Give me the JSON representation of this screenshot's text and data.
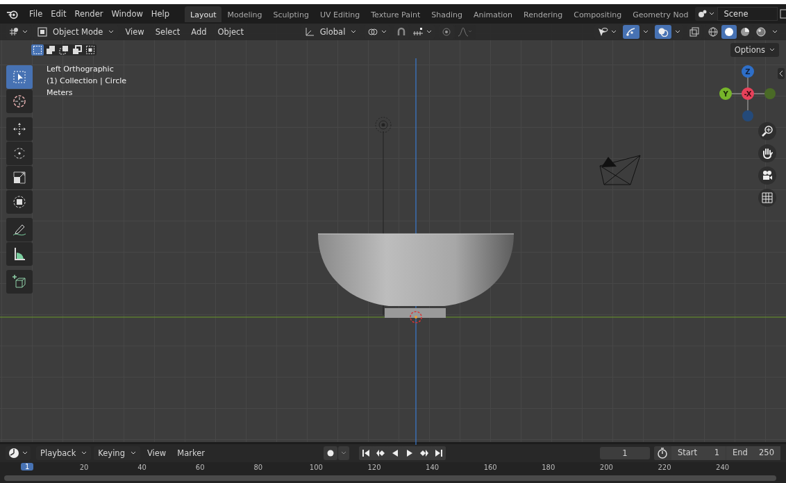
{
  "menu": [
    "File",
    "Edit",
    "Render",
    "Window",
    "Help"
  ],
  "workspaces": [
    {
      "label": "Layout",
      "selected": true
    },
    {
      "label": "Modeling",
      "selected": false
    },
    {
      "label": "Sculpting",
      "selected": false
    },
    {
      "label": "UV Editing",
      "selected": false
    },
    {
      "label": "Texture Paint",
      "selected": false
    },
    {
      "label": "Shading",
      "selected": false
    },
    {
      "label": "Animation",
      "selected": false
    },
    {
      "label": "Rendering",
      "selected": false
    },
    {
      "label": "Compositing",
      "selected": false
    },
    {
      "label": "Geometry Nod",
      "selected": false
    }
  ],
  "scene": "Scene",
  "header": {
    "mode": "Object Mode",
    "menus": [
      "View",
      "Select",
      "Add",
      "Object"
    ],
    "orientation": "Global",
    "snap": {
      "on": false
    },
    "proportional_editing": {
      "on": false
    },
    "gizmos": {
      "on": true
    },
    "overlays": {
      "on": true
    },
    "xray": {
      "on": false
    },
    "shading": [
      {
        "kind": "wireframe",
        "selected": false
      },
      {
        "kind": "solid",
        "selected": true
      },
      {
        "kind": "material",
        "selected": false
      },
      {
        "kind": "rendered",
        "selected": false
      }
    ]
  },
  "select_modes": [
    {
      "kind": "new",
      "selected": true
    },
    {
      "kind": "extend",
      "selected": false
    },
    {
      "kind": "subtract",
      "selected": false
    },
    {
      "kind": "invert",
      "selected": false
    },
    {
      "kind": "intersect",
      "selected": false
    }
  ],
  "options": "Options",
  "overlay_text": [
    "Left Orthographic",
    "(1) Collection | Circle",
    "Meters"
  ],
  "tools": [
    {
      "kind": "select",
      "selected": true
    },
    {
      "kind": "cursor",
      "selected": false
    },
    {
      "kind": "move",
      "selected": false
    },
    {
      "kind": "rotate",
      "selected": false
    },
    {
      "kind": "scale",
      "selected": false
    },
    {
      "kind": "transform",
      "selected": false
    },
    {
      "kind": "annotate",
      "selected": false
    },
    {
      "kind": "measure",
      "selected": false
    },
    {
      "kind": "add_cube",
      "selected": false
    }
  ],
  "gizmo": [
    {
      "kind": "z",
      "label": "Z"
    },
    {
      "kind": "y",
      "label": "Y"
    },
    {
      "kind": "x",
      "label": "-X"
    }
  ],
  "nav_buttons": [
    {
      "kind": "zoom"
    },
    {
      "kind": "pan"
    },
    {
      "kind": "camera"
    },
    {
      "kind": "ortho"
    }
  ],
  "timeline": {
    "menus": [
      {
        "label": "Playback",
        "kind": "dropdown"
      },
      {
        "label": "Keying",
        "kind": "dropdown"
      },
      {
        "label": "View",
        "kind": "menu"
      },
      {
        "label": "Marker",
        "kind": "menu"
      }
    ],
    "auto_keying": {
      "on": false
    },
    "current_frame": "1",
    "start_label": "Start",
    "start": "1",
    "end_label": "End",
    "end": "250",
    "playhead": "1",
    "ruler": [
      "20",
      "40",
      "60",
      "80",
      "100",
      "120",
      "140",
      "160",
      "180",
      "200",
      "220",
      "240"
    ]
  }
}
